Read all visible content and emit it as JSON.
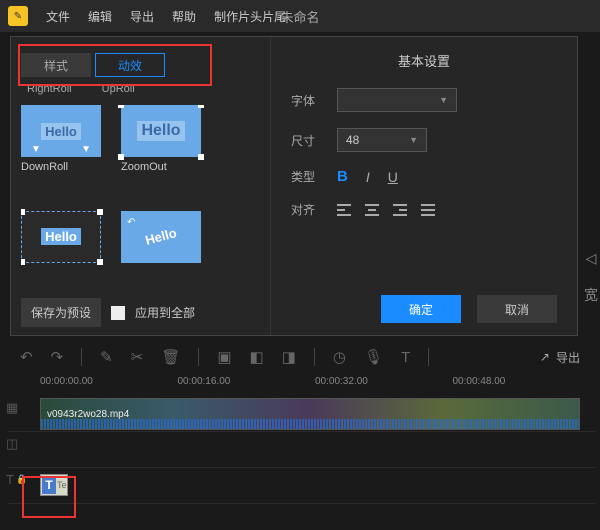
{
  "topbar": {
    "menus": [
      "文件",
      "编辑",
      "导出",
      "帮助",
      "制作片头片尾"
    ],
    "title": "未命名"
  },
  "panel": {
    "tabs": {
      "style": "样式",
      "motion": "动效"
    },
    "row_labels": [
      "RightRoll",
      "UpRoll"
    ],
    "thumbs": [
      {
        "label": "DownRoll",
        "text": "Hello"
      },
      {
        "label": "ZoomOut",
        "text": "Hello"
      },
      {
        "label": "",
        "text": "Hello"
      },
      {
        "label": "",
        "text": "Hello"
      }
    ],
    "save_preset": "保存为预设",
    "apply_all": "应用到全部"
  },
  "settings": {
    "title": "基本设置",
    "font_label": "字体",
    "font_value": "",
    "size_label": "尺寸",
    "size_value": "48",
    "type_label": "类型",
    "type_b": "B",
    "type_i": "I",
    "type_u": "U",
    "align_label": "对齐",
    "ok": "确定",
    "cancel": "取消"
  },
  "side": {
    "play": "◁",
    "wide": "宽"
  },
  "toolbar": {
    "export": "导出"
  },
  "ruler": [
    "00:00:00.00",
    "00:00:16.00",
    "00:00:32.00",
    "00:00:48.00"
  ],
  "clip": {
    "name": "v0943r2wo28.mp4"
  },
  "text_clip": {
    "t": "T",
    "suffix": "Te"
  }
}
